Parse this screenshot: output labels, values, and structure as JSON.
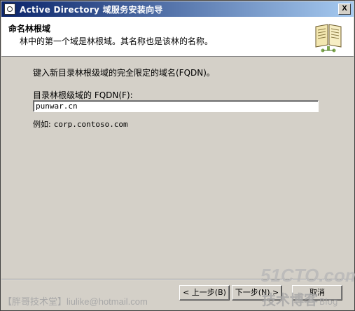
{
  "window": {
    "title": "Active Directory 域服务安装向导",
    "close_label": "X"
  },
  "header": {
    "title": "命名林根域",
    "subtitle": "林中的第一个域是林根域。其名称也是该林的名称。",
    "icon": "book-icon"
  },
  "content": {
    "prompt": "键入新目录林根级域的完全限定的域名(FQDN)。",
    "fqdn_label": "目录林根级域的 FQDN(F):",
    "fqdn_value": "punwar.cn",
    "example_label": "例如:",
    "example_value": "corp.contoso.com"
  },
  "buttons": {
    "back": "< 上一步(B)",
    "next": "下一步(N) >",
    "cancel": "取消"
  },
  "watermarks": {
    "left": "【胖哥技术堂】liulike@hotmail.com",
    "logo": "51CTO.com",
    "blog_cn": "技术博客",
    "blog_en": "Blog"
  },
  "colors": {
    "title_gradient_start": "#0a246a",
    "title_gradient_end": "#a6caf0",
    "dialog_bg": "#d4d0c8"
  }
}
